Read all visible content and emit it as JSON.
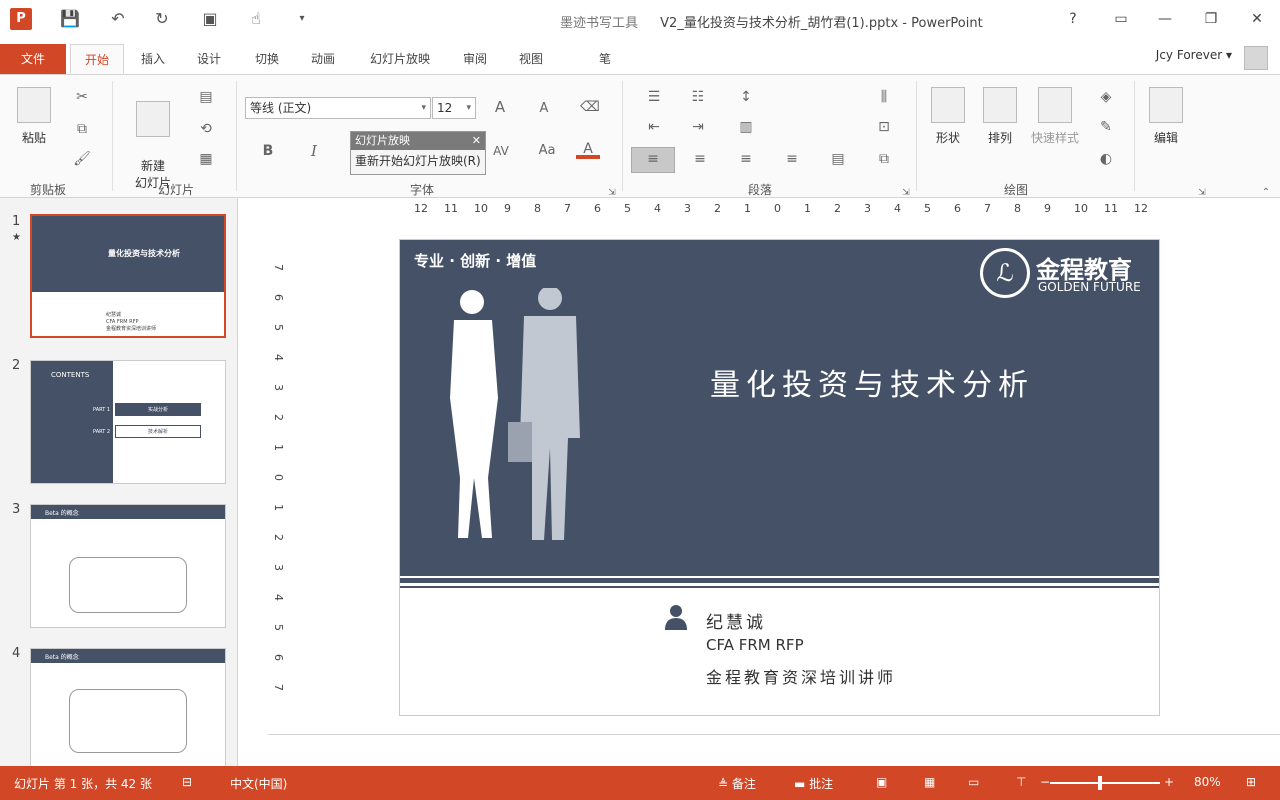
{
  "window": {
    "app_icon": "P",
    "tool_context": "墨迹书写工具",
    "title": "V2_量化投资与技术分析_胡竹君(1).pptx - PowerPoint",
    "help": "?"
  },
  "tabs": {
    "items": [
      "文件",
      "开始",
      "插入",
      "设计",
      "切换",
      "动画",
      "幻灯片放映",
      "审阅",
      "视图",
      "笔"
    ],
    "active": "开始",
    "user": "Jcy Forever",
    "user_dropdown": "▾"
  },
  "ribbon": {
    "clipboard": {
      "paste": "粘贴",
      "group": "剪贴板"
    },
    "slides": {
      "new_slide": "新建\n幻灯片",
      "group": "幻灯片"
    },
    "font": {
      "family": "等线 (正文)",
      "size": "12",
      "bold": "B",
      "italic": "I",
      "spacing": "AV",
      "case": "Aa",
      "color": "A",
      "grow": "A",
      "shrink": "A",
      "group": "字体"
    },
    "popup": {
      "header": "幻灯片放映",
      "item": "重新开始幻灯片放映(R)",
      "close": "✕"
    },
    "paragraph": {
      "group": "段落"
    },
    "drawing": {
      "shapes": "形状",
      "arrange": "排列",
      "quick_styles": "快速样式",
      "group": "绘图"
    },
    "editing": {
      "edit": "编辑"
    }
  },
  "ruler": {
    "top": [
      "12",
      "11",
      "10",
      "9",
      "8",
      "7",
      "6",
      "5",
      "4",
      "3",
      "2",
      "1",
      "0",
      "1",
      "2",
      "3",
      "4",
      "5",
      "6",
      "7",
      "8",
      "9",
      "10",
      "11",
      "12"
    ],
    "left": [
      "7",
      "6",
      "5",
      "4",
      "3",
      "2",
      "1",
      "0",
      "1",
      "2",
      "3",
      "4",
      "5",
      "6",
      "7"
    ]
  },
  "thumbnails": [
    {
      "num": "1",
      "star": "★",
      "title": "量化投资与技术分析",
      "body": [
        "纪慧诚",
        "CFA FRM RFP",
        "金程教育资深培训讲师"
      ]
    },
    {
      "num": "2",
      "contents": "CONTENTS",
      "part1": "PART 1",
      "part1_label": "实战分析",
      "part2": "PART 2",
      "part2_label": "技术解析"
    },
    {
      "num": "3",
      "header": "Beta 的概念"
    },
    {
      "num": "4",
      "header": "Beta 的概念"
    }
  ],
  "slide": {
    "tagline": "专业 · 创新 · 增值",
    "logo_cn": "金程教育",
    "logo_en": "GOLDEN FUTURE",
    "title": "量化投资与技术分析",
    "presenter": "纪慧诚",
    "credentials": "CFA FRM RFP",
    "role": "金程教育资深培训讲师"
  },
  "status": {
    "slide_info": "幻灯片 第 1 张，共 42 张",
    "language": "中文(中国)",
    "notes": "备注",
    "comments": "批注",
    "zoom_minus": "−",
    "zoom_plus": "+",
    "zoom": "80%"
  },
  "colors": {
    "accent": "#d24726",
    "slide_bg": "#455166"
  }
}
